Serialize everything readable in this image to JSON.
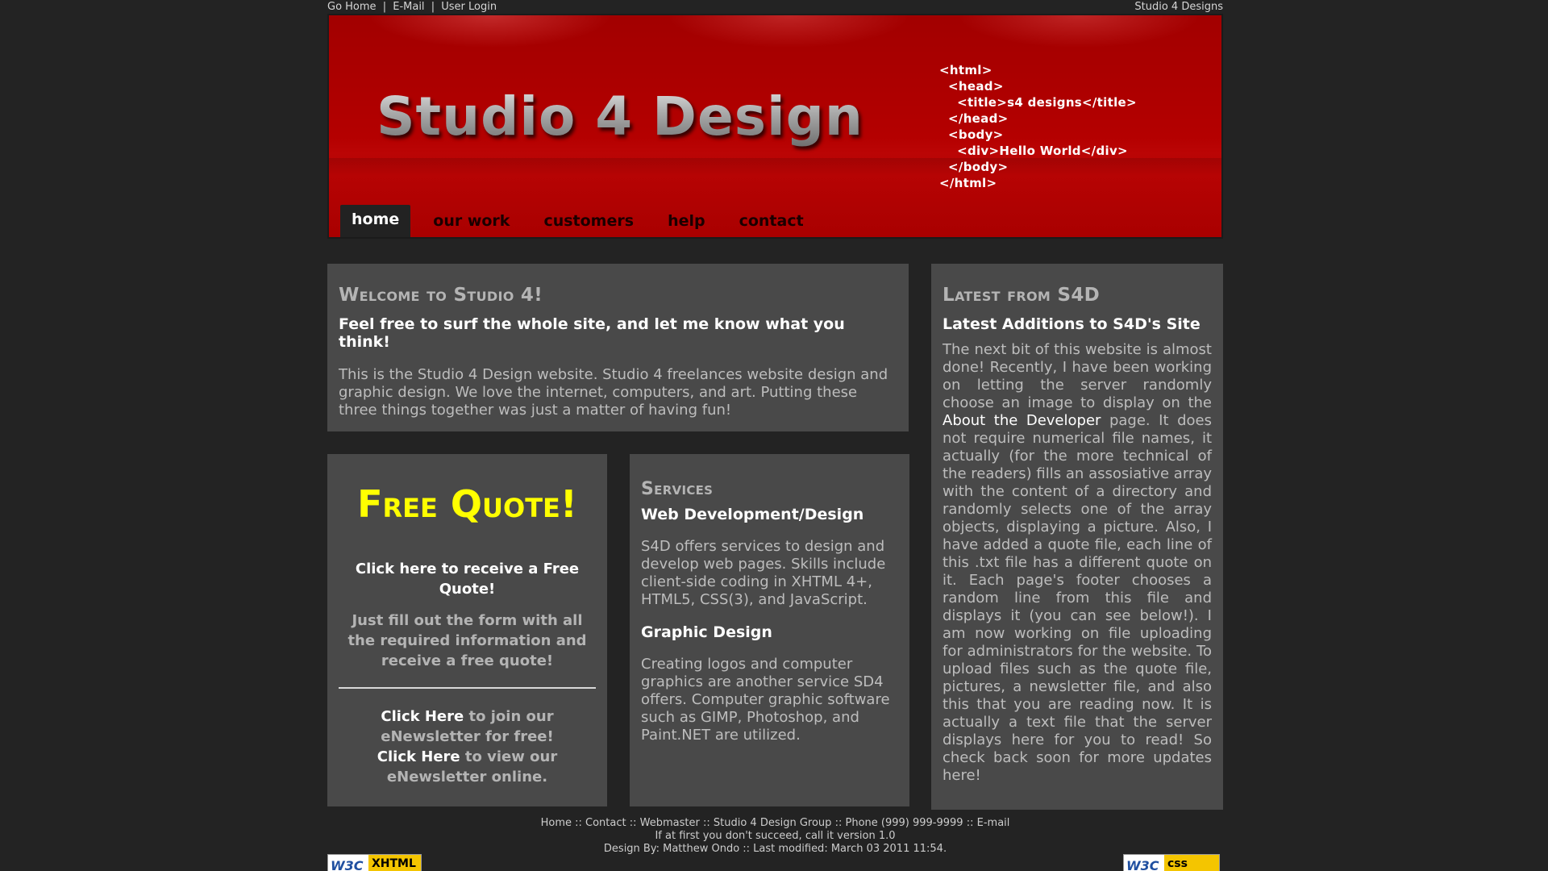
{
  "topbar": {
    "links": [
      "Go Home",
      "E-Mail",
      "User Login"
    ],
    "separator": "|",
    "brand": "Studio 4 Designs"
  },
  "header": {
    "logo": "Studio 4 Design",
    "code_lines": [
      "<html>",
      "  <head>",
      "    <title>s4 designs</title>",
      "  </head>",
      "  <body>",
      "    <div>Hello World</div>",
      "  </body>",
      "</html>"
    ]
  },
  "nav": {
    "tabs": [
      "home",
      "our work",
      "customers",
      "help",
      "contact"
    ],
    "active": "home"
  },
  "welcome": {
    "title": "Welcome to Studio 4!",
    "subtitle": "Feel free to surf the whole site, and let me know what you think!",
    "body": "This is the Studio 4 Design website. Studio 4 freelances website design and graphic design. We love the internet, computers, and art. Putting these three things together was just a matter of having fun!"
  },
  "quote": {
    "title": "Free Quote!",
    "cta": "Click here to receive a Free Quote!",
    "desc": "Just fill out the form with all the required information and receive a free quote!",
    "join_link": "Click Here",
    "join_text": " to join our eNewsletter for free!",
    "view_link": "Click Here",
    "view_text": " to view our eNewsletter online."
  },
  "services": {
    "title": "Services",
    "web_title": "Web Development/Design",
    "web_body": "S4D offers services to design and develop web pages. Skills include client-side coding in XHTML 4+, HTML5, CSS(3), and JavaScript.",
    "graphic_title": "Graphic Design",
    "graphic_body": "Creating logos and computer graphics are another service SD4 offers. Computer graphic software such as GIMP, Photoshop, and Paint.NET are utilized."
  },
  "latest": {
    "title": "Latest from S4D",
    "subtitle": "Latest Additions to S4D's Site",
    "body_before": "The next bit of this website is almost done! Recently, I have been working on letting the server randomly choose an image to display on the ",
    "link": "About the Developer",
    "body_after": " page. It does not require numerical file names, it actually (for the more technical of the readers) fills an assosiative array with the content of a directory and randomly selects one of the array objects, displaying a picture. Also, I have added a quote file, each line of this .txt file has a different quote on it. Each page's footer chooses a random line from this file and displays it (you can see below!). I am now working on file uploading for administrators for the website. To upload files such as the quote file, pictures, a newsletter file, and also this that you are reading now. It is actually a text file that the server displays here for you to read! So check back soon for more updates here!"
  },
  "footer": {
    "links": [
      "Home",
      "Contact",
      "Webmaster",
      "Studio 4 Design Group",
      "Phone (999) 999-9999",
      "E-mail"
    ],
    "separator": "::",
    "quote": "If at first you don't succeed, call it version 1.0",
    "credits": "Design By: Matthew Ondo :: Last modified: March 03 2011 11:54."
  },
  "badges": {
    "w3": "W3C",
    "xhtml": "XHTML",
    "css": "css"
  },
  "colors": {
    "page_bg": "#232323",
    "header_red": "#b40000",
    "panel_bg": "#494949",
    "accent_yellow": "#ffff00"
  }
}
